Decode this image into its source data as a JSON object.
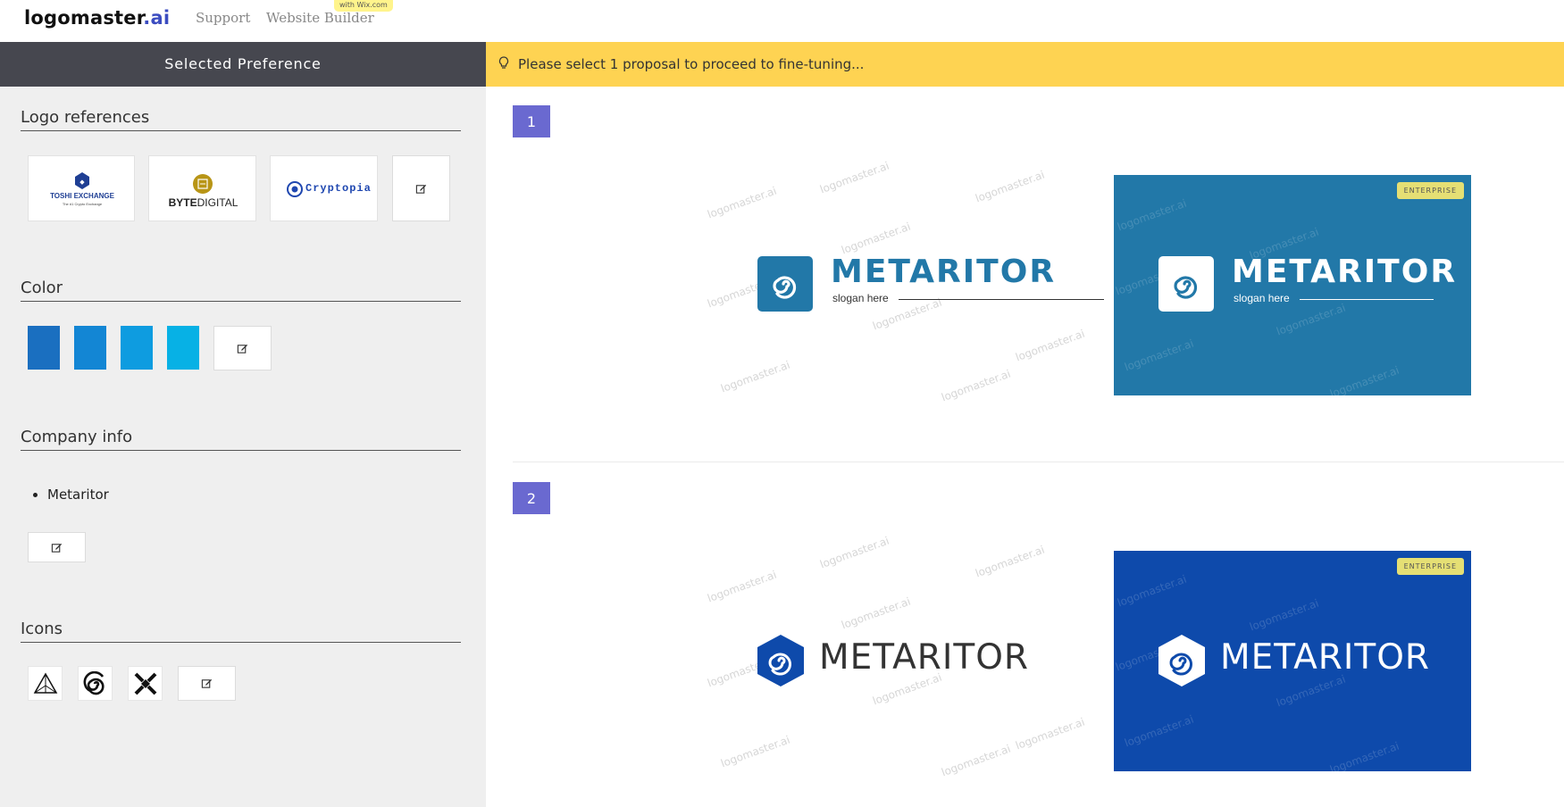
{
  "header": {
    "logo_main": "logomaster",
    "logo_suffix": ".ai",
    "nav": [
      "Support",
      "Website Builder"
    ],
    "wix_badge": "with Wix.com"
  },
  "sidebar": {
    "title": "Selected Preference",
    "logo_refs_title": "Logo references",
    "logo_refs": [
      {
        "name": "TOSHI EXCHANGE",
        "tagline": "The #1 Crypto Exchange"
      },
      {
        "name_a": "BYTE",
        "name_b": "DIGITAL"
      },
      {
        "name": "Cryptopia"
      }
    ],
    "color_title": "Color",
    "colors": [
      "#1a6fc0",
      "#1386d4",
      "#0e9ce0",
      "#07b1e5"
    ],
    "company_title": "Company info",
    "company_items": [
      "Metaritor"
    ],
    "icons_title": "Icons",
    "icons": [
      "triangle-icon",
      "spiral-icon",
      "cross-icon"
    ]
  },
  "banner": {
    "text": "Please select 1 proposal to proceed to fine-tuning..."
  },
  "proposals": [
    {
      "number": "1",
      "brand": "METARITOR",
      "slogan": "slogan here",
      "accent": "#2278a8",
      "badge": "ENTERPRISE"
    },
    {
      "number": "2",
      "brand": "METARITOR",
      "accent": "#0e4aab",
      "badge": "ENTERPRISE"
    }
  ],
  "watermark": "logomaster.ai"
}
